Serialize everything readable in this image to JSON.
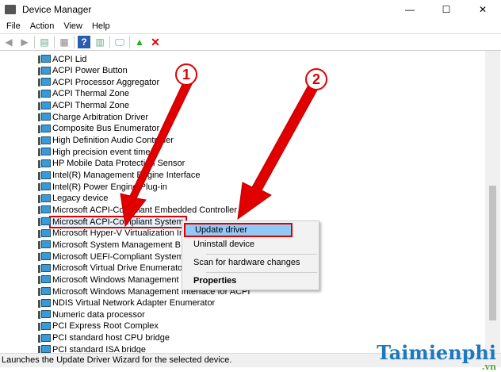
{
  "window": {
    "title": "Device Manager",
    "minimize": "—",
    "maximize": "☐",
    "close": "✕"
  },
  "menu": [
    "File",
    "Action",
    "View",
    "Help"
  ],
  "devices": [
    "ACPI Lid",
    "ACPI Power Button",
    "ACPI Processor Aggregator",
    "ACPI Thermal Zone",
    "ACPI Thermal Zone",
    "Charge Arbitration Driver",
    "Composite Bus Enumerator",
    "High Definition Audio Controller",
    "High precision event timer",
    "HP Mobile Data Protection Sensor",
    "Intel(R) Management Engine Interface",
    "Intel(R) Power Engine Plug-in",
    "Legacy device",
    "Microsoft ACPI-Compliant Embedded Controller",
    "Microsoft ACPI-Compliant System",
    "Microsoft Hyper-V Virtualization Infrastructure Driver",
    "Microsoft System Management BIOS Driver",
    "Microsoft UEFI-Compliant System",
    "Microsoft Virtual Drive Enumerator",
    "Microsoft Windows Management Interface for ACPI",
    "Microsoft Windows Management Interface for ACPI",
    "NDIS Virtual Network Adapter Enumerator",
    "Numeric data processor",
    "PCI Express Root Complex",
    "PCI standard host CPU bridge",
    "PCI standard ISA bridge"
  ],
  "context_menu": {
    "update": "Update driver",
    "uninstall": "Uninstall device",
    "scan": "Scan for hardware changes",
    "properties": "Properties"
  },
  "status": "Launches the Update Driver Wizard for the selected device.",
  "annotations": [
    "1",
    "2"
  ],
  "watermark": {
    "name": "Taimienphi",
    "tld": ".vn"
  }
}
